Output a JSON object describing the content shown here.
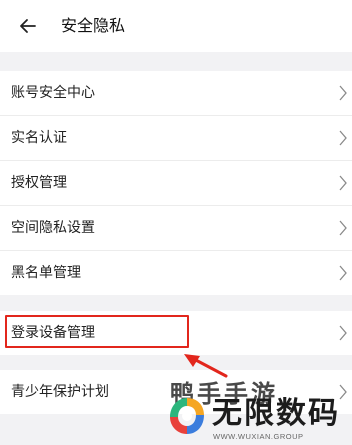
{
  "header": {
    "title": "安全隐私",
    "back_icon": "back-arrow-icon"
  },
  "colors": {
    "background": "#ffffff",
    "section_gap": "#f2f2f4",
    "highlight": "#e2261c"
  },
  "menu": {
    "group1": [
      {
        "label": "账号安全中心"
      },
      {
        "label": "实名认证"
      },
      {
        "label": "授权管理"
      },
      {
        "label": "空间隐私设置"
      },
      {
        "label": "黑名单管理"
      }
    ],
    "group2": [
      {
        "label": "登录设备管理"
      }
    ],
    "group3": [
      {
        "label": "青少年保护计划"
      }
    ]
  },
  "watermark": {
    "ghost_text": "鸭手手游",
    "brand": "无限数码",
    "url": "WWW.WUXIAN.GROUP"
  }
}
